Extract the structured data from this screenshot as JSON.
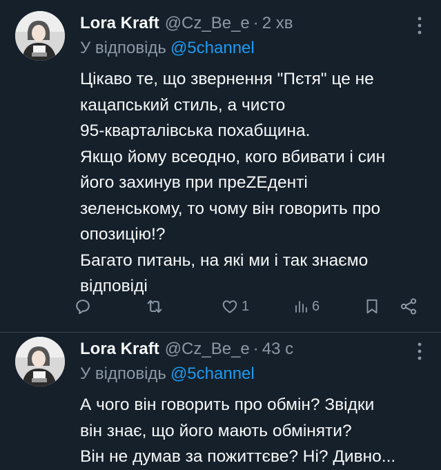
{
  "tweets": [
    {
      "author_name": "Lora Kraft",
      "handle": "@Cz_Be_e",
      "separator": "·",
      "time": "2 хв",
      "reply_prefix": "У відповідь",
      "reply_to": "@5channel",
      "lines": [
        "Цікаво те, що звернення \"Пєтя\" це не",
        "кацапський стиль, а чисто",
        "95-кварталівська похабщина.",
        "Якщо йому всеодно, кого вбивати і син",
        "його захинув при преZЕденті",
        "зеленському, то чому він говорить про",
        "опозицію!?",
        "Багато питань, на які ми і так знаємо",
        "відповіді"
      ],
      "actions": {
        "reply_icon": "reply-icon",
        "retweet_icon": "retweet-icon",
        "like_icon": "heart-icon",
        "like_count": "1",
        "views_icon": "views-icon",
        "views_count": "6",
        "bookmark_icon": "bookmark-icon",
        "share_icon": "share-icon"
      }
    },
    {
      "author_name": "Lora Kraft",
      "handle": "@Cz_Be_e",
      "separator": "·",
      "time": "43 с",
      "reply_prefix": "У відповідь",
      "reply_to": "@5channel",
      "lines": [
        "А чого він говорить про обмін? Звідки",
        "він знає, що його мають обміняти?",
        "Він не думав за пожиттєве? Ні? Дивно..."
      ]
    }
  ],
  "colors": {
    "background": "#15202b",
    "text": "#f7f9f9",
    "secondary": "#8b98a5",
    "accent": "#1d9bf0",
    "divider": "#38444d"
  }
}
